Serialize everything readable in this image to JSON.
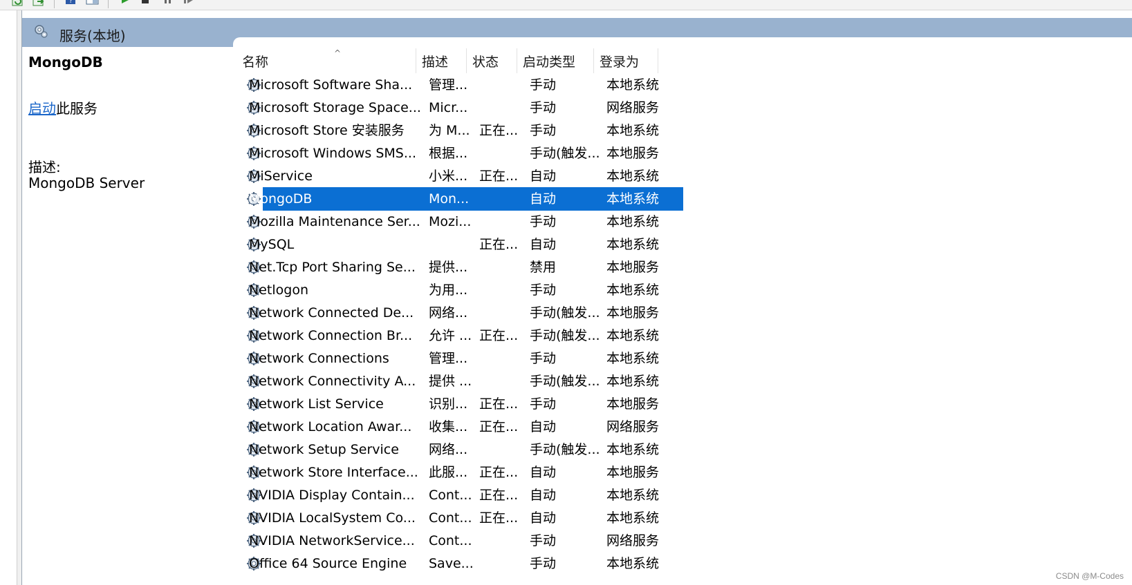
{
  "header": {
    "title": "服务(本地)",
    "icon": "services-gear-icon"
  },
  "selected_service": {
    "name": "MongoDB",
    "start_link": "启动",
    "start_suffix": "此服务",
    "desc_label": "描述:",
    "description": "MongoDB Server"
  },
  "table": {
    "columns": [
      {
        "key": "name",
        "label": "名称"
      },
      {
        "key": "desc",
        "label": "描述"
      },
      {
        "key": "status",
        "label": "状态"
      },
      {
        "key": "startup",
        "label": "启动类型"
      },
      {
        "key": "logon",
        "label": "登录为"
      }
    ],
    "sort_indicator": "^",
    "rows": [
      {
        "name": "Microsoft Software Sha...",
        "desc": "管理...",
        "status": "",
        "startup": "手动",
        "logon": "本地系统"
      },
      {
        "name": "Microsoft Storage Space...",
        "desc": "Micr...",
        "status": "",
        "startup": "手动",
        "logon": "网络服务"
      },
      {
        "name": "Microsoft Store 安装服务",
        "desc": "为 M...",
        "status": "正在...",
        "startup": "手动",
        "logon": "本地系统"
      },
      {
        "name": "Microsoft Windows SMS...",
        "desc": "根据...",
        "status": "",
        "startup": "手动(触发...",
        "logon": "本地服务"
      },
      {
        "name": "MiService",
        "desc": "小米...",
        "status": "正在...",
        "startup": "自动",
        "logon": "本地系统"
      },
      {
        "name": "MongoDB",
        "desc": "Mon...",
        "status": "",
        "startup": "自动",
        "logon": "本地系统",
        "selected": true
      },
      {
        "name": "Mozilla Maintenance Ser...",
        "desc": "Mozi...",
        "status": "",
        "startup": "手动",
        "logon": "本地系统"
      },
      {
        "name": "MySQL",
        "desc": "",
        "status": "正在...",
        "startup": "自动",
        "logon": "本地系统"
      },
      {
        "name": "Net.Tcp Port Sharing Se...",
        "desc": "提供...",
        "status": "",
        "startup": "禁用",
        "logon": "本地服务"
      },
      {
        "name": "Netlogon",
        "desc": "为用...",
        "status": "",
        "startup": "手动",
        "logon": "本地系统"
      },
      {
        "name": "Network Connected De...",
        "desc": "网络...",
        "status": "",
        "startup": "手动(触发...",
        "logon": "本地服务"
      },
      {
        "name": "Network Connection Br...",
        "desc": "允许 ...",
        "status": "正在...",
        "startup": "手动(触发...",
        "logon": "本地系统"
      },
      {
        "name": "Network Connections",
        "desc": "管理...",
        "status": "",
        "startup": "手动",
        "logon": "本地系统"
      },
      {
        "name": "Network Connectivity A...",
        "desc": "提供 ...",
        "status": "",
        "startup": "手动(触发...",
        "logon": "本地系统"
      },
      {
        "name": "Network List Service",
        "desc": "识别...",
        "status": "正在...",
        "startup": "手动",
        "logon": "本地服务"
      },
      {
        "name": "Network Location Awar...",
        "desc": "收集...",
        "status": "正在...",
        "startup": "自动",
        "logon": "网络服务"
      },
      {
        "name": "Network Setup Service",
        "desc": "网络...",
        "status": "",
        "startup": "手动(触发...",
        "logon": "本地系统"
      },
      {
        "name": "Network Store Interface...",
        "desc": "此服...",
        "status": "正在...",
        "startup": "自动",
        "logon": "本地服务"
      },
      {
        "name": "NVIDIA Display Contain...",
        "desc": "Cont...",
        "status": "正在...",
        "startup": "自动",
        "logon": "本地系统"
      },
      {
        "name": "NVIDIA LocalSystem Co...",
        "desc": "Cont...",
        "status": "正在...",
        "startup": "自动",
        "logon": "本地系统"
      },
      {
        "name": "NVIDIA NetworkService...",
        "desc": "Cont...",
        "status": "",
        "startup": "手动",
        "logon": "网络服务"
      },
      {
        "name": "Office 64 Source Engine",
        "desc": "Save...",
        "status": "",
        "startup": "手动",
        "logon": "本地系统"
      }
    ]
  },
  "watermark": "CSDN @M-Codes",
  "colors": {
    "header_bar": "#99b2cf",
    "selection": "#0b6fd3",
    "link": "#1a66c9"
  }
}
